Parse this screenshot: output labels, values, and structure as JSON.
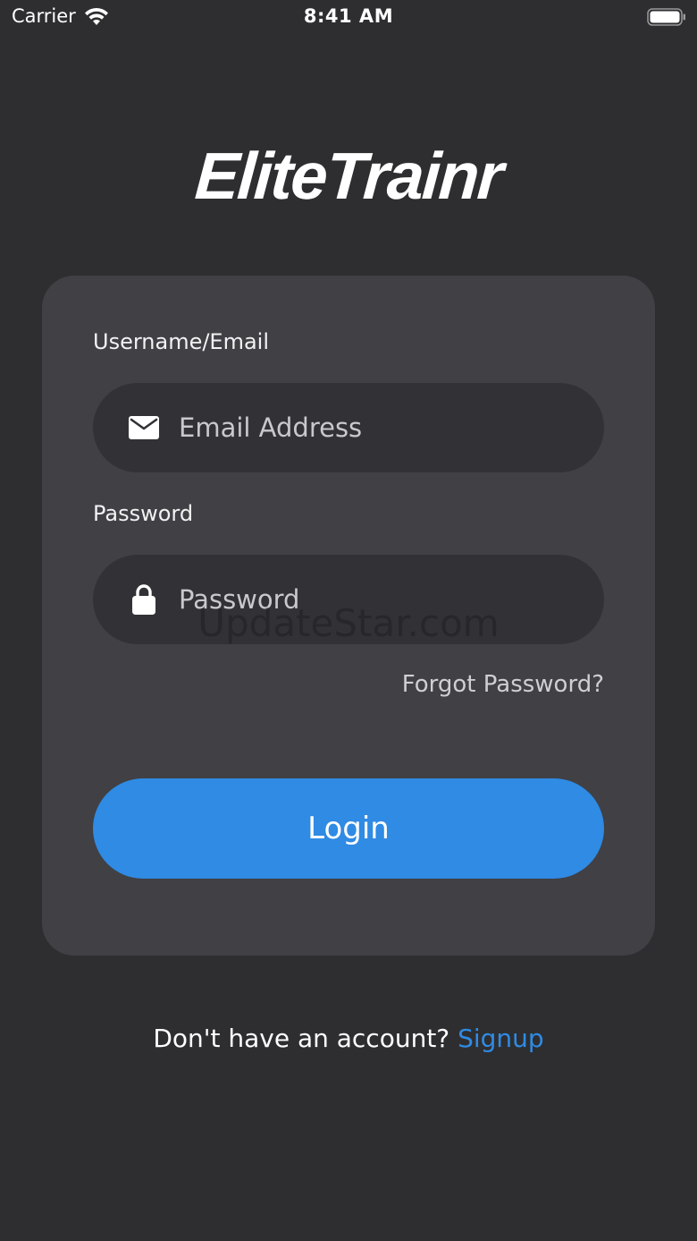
{
  "status_bar": {
    "carrier": "Carrier",
    "time": "8:41 AM"
  },
  "logo": {
    "text": "EliteTrainr"
  },
  "form": {
    "username_label": "Username/Email",
    "email_placeholder": "Email Address",
    "email_value": "",
    "password_label": "Password",
    "password_placeholder": "Password",
    "password_value": "",
    "forgot_label": "Forgot Password?",
    "login_label": "Login"
  },
  "footer": {
    "prompt": "Don't have an account?",
    "signup_label": "Signup"
  },
  "watermark": {
    "text": "UpdateStar.com"
  },
  "icons": {
    "email": "envelope-icon",
    "password": "lock-icon",
    "wifi": "wifi-icon",
    "battery": "battery-icon"
  },
  "colors": {
    "background": "#2e2e30",
    "card": "#404045",
    "input": "#323236",
    "accent": "#2f8be4"
  }
}
